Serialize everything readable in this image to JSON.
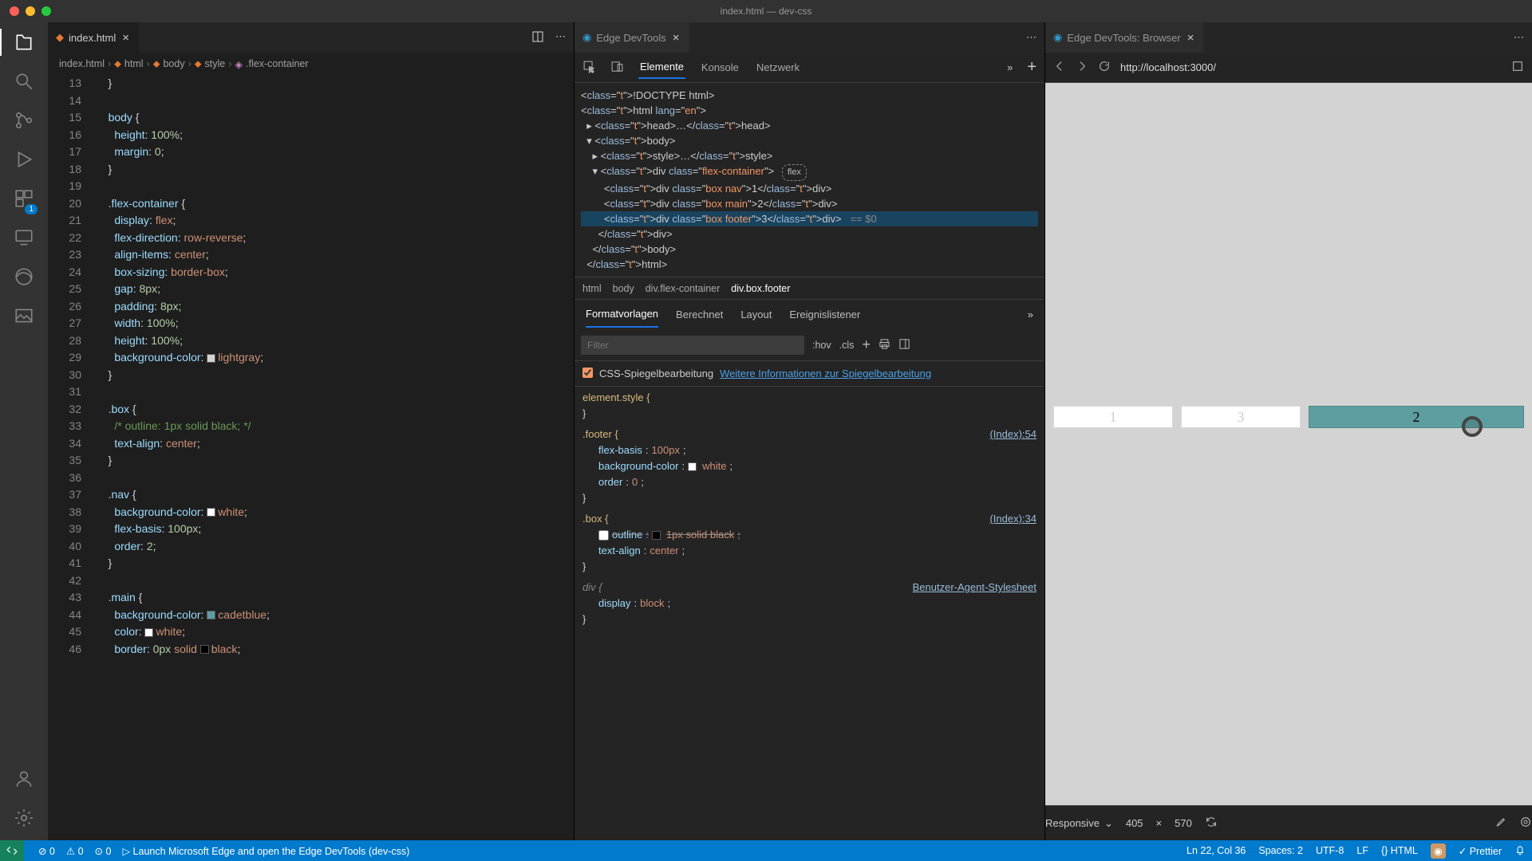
{
  "window": {
    "title": "index.html — dev-css"
  },
  "editor": {
    "tab": {
      "label": "index.html"
    },
    "breadcrumb": [
      "index.html",
      "html",
      "body",
      "style",
      ".flex-container"
    ],
    "lines": [
      {
        "n": 13,
        "html": "    }"
      },
      {
        "n": 14,
        "html": ""
      },
      {
        "n": 15,
        "html": "    <span class='k-sel'>body</span> {"
      },
      {
        "n": 16,
        "html": "      <span class='k-prop'>height</span>: <span class='k-num'>100%</span>;"
      },
      {
        "n": 17,
        "html": "      <span class='k-prop'>margin</span>: <span class='k-num'>0</span>;"
      },
      {
        "n": 18,
        "html": "    }"
      },
      {
        "n": 19,
        "html": ""
      },
      {
        "n": 20,
        "html": "    <span class='k-sel'>.flex-container</span> {"
      },
      {
        "n": 21,
        "html": "      <span class='k-prop'>display</span>: <span class='k-val'>flex</span>;"
      },
      {
        "n": 22,
        "html": "      <span class='k-prop'>flex-direction</span>: <span class='k-val'>row-reverse</span>;"
      },
      {
        "n": 23,
        "html": "      <span class='k-prop'>align-items</span>: <span class='k-val'>center</span>;"
      },
      {
        "n": 24,
        "html": "      <span class='k-prop'>box-sizing</span>: <span class='k-val'>border-box</span>;"
      },
      {
        "n": 25,
        "html": "      <span class='k-prop'>gap</span>: <span class='k-num'>8px</span>;"
      },
      {
        "n": 26,
        "html": "      <span class='k-prop'>padding</span>: <span class='k-num'>8px</span>;"
      },
      {
        "n": 27,
        "html": "      <span class='k-prop'>width</span>: <span class='k-num'>100%</span>;"
      },
      {
        "n": 28,
        "html": "      <span class='k-prop'>height</span>: <span class='k-num'>100%</span>;"
      },
      {
        "n": 29,
        "html": "      <span class='k-prop'>background-color</span>: <span class='swatch' style='background:lightgray'></span><span class='k-val'>lightgray</span>;"
      },
      {
        "n": 30,
        "html": "    }"
      },
      {
        "n": 31,
        "html": ""
      },
      {
        "n": 32,
        "html": "    <span class='k-sel'>.box</span> {"
      },
      {
        "n": 33,
        "html": "      <span class='k-com'>/* outline: 1px solid black; */</span>"
      },
      {
        "n": 34,
        "html": "      <span class='k-prop'>text-align</span>: <span class='k-val'>center</span>;"
      },
      {
        "n": 35,
        "html": "    }"
      },
      {
        "n": 36,
        "html": ""
      },
      {
        "n": 37,
        "html": "    <span class='k-sel'>.nav</span> {"
      },
      {
        "n": 38,
        "html": "      <span class='k-prop'>background-color</span>: <span class='swatch' style='background:white'></span><span class='k-val'>white</span>;"
      },
      {
        "n": 39,
        "html": "      <span class='k-prop'>flex-basis</span>: <span class='k-num'>100px</span>;"
      },
      {
        "n": 40,
        "html": "      <span class='k-prop'>order</span>: <span class='k-num'>2</span>;"
      },
      {
        "n": 41,
        "html": "    }"
      },
      {
        "n": 42,
        "html": ""
      },
      {
        "n": 43,
        "html": "    <span class='k-sel'>.main</span> {"
      },
      {
        "n": 44,
        "html": "      <span class='k-prop'>background-color</span>: <span class='swatch' style='background:cadetblue'></span><span class='k-val'>cadetblue</span>;"
      },
      {
        "n": 45,
        "html": "      <span class='k-prop'>color</span>: <span class='swatch' style='background:white'></span><span class='k-val'>white</span>;"
      },
      {
        "n": 46,
        "html": "      <span class='k-prop'>border</span>: <span class='k-num'>0px</span> <span class='k-val'>solid</span> <span class='swatch' style='background:black'></span><span class='k-val'>black</span>;"
      }
    ]
  },
  "devtools": {
    "tab_title": "Edge DevTools",
    "header_tabs": [
      "Elemente",
      "Konsole",
      "Netzwerk"
    ],
    "dom": [
      "<!DOCTYPE html>",
      "<html lang=\"en\">",
      "  ▸ <head>…</head>",
      "  ▾ <body>",
      "    ▸ <style>…</style>",
      "    ▾ <div class=\"flex-container\"> ",
      "        <div class=\"box nav\">1</div>",
      "        <div class=\"box main\">2</div>",
      "        <div class=\"box footer\">3</div>   == $0",
      "      </div>",
      "    </body>",
      "  </html>"
    ],
    "dom_crumb": [
      "html",
      "body",
      "div.flex-container",
      "div.box.footer"
    ],
    "styles_tabs": [
      "Formatvorlagen",
      "Berechnet",
      "Layout",
      "Ereignislistener"
    ],
    "filter_placeholder": "Filter",
    "hov": ":hov",
    "cls": ".cls",
    "mirror_label": "CSS-Spiegelbearbeitung",
    "mirror_link": "Weitere Informationen zur Spiegelbearbeitung",
    "rules": {
      "element_style": "element.style {",
      "footer": {
        "sel": ".footer {",
        "src": "(Index):54",
        "props": [
          {
            "p": "flex-basis",
            "v": "100px"
          },
          {
            "p": "background-color",
            "v": "white",
            "sw": "#fff"
          },
          {
            "p": "order",
            "v": "0"
          }
        ]
      },
      "box": {
        "sel": ".box {",
        "src": "(Index):34",
        "props": [
          {
            "p": "outline",
            "v": "1px solid black",
            "strike": true,
            "sw": "#000"
          },
          {
            "p": "text-align",
            "v": "center"
          }
        ]
      },
      "div": {
        "sel": "div {",
        "src": "Benutzer-Agent-Stylesheet",
        "props": [
          {
            "p": "display",
            "v": "block"
          }
        ]
      }
    }
  },
  "browser": {
    "tab_title": "Edge DevTools: Browser",
    "url": "http://localhost:3000/",
    "boxes": [
      "1",
      "3",
      "2"
    ],
    "responsive": "Responsive",
    "width": "405",
    "height": "570"
  },
  "status": {
    "errors": "0",
    "warnings": "0",
    "port": "0",
    "launch": "Launch Microsoft Edge and open the Edge DevTools (dev-css)",
    "pos": "Ln 22, Col 36",
    "spaces": "Spaces: 2",
    "encoding": "UTF-8",
    "eol": "LF",
    "lang": "HTML",
    "prettier": "Prettier"
  },
  "ext_badge": "1"
}
